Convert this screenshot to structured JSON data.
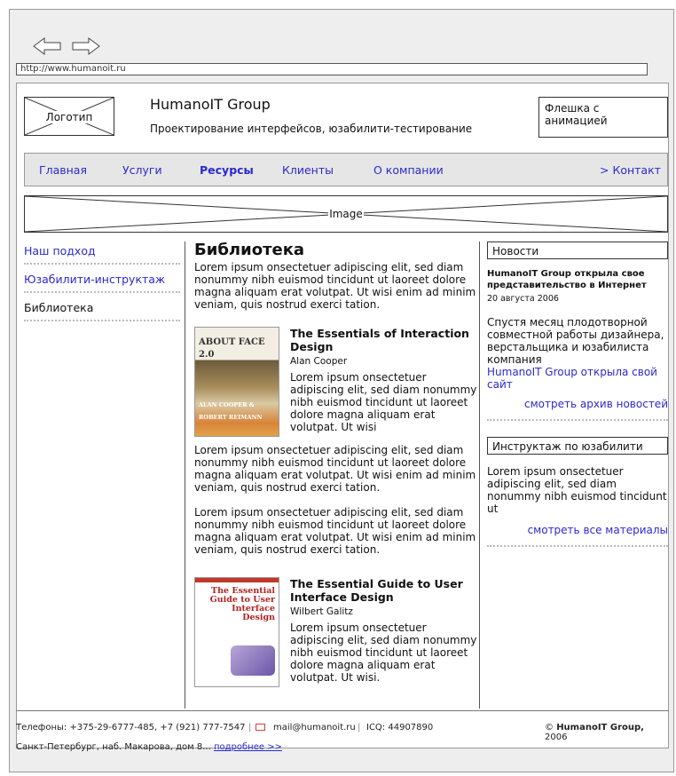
{
  "browser": {
    "url": "http://www.humanoit.ru"
  },
  "header": {
    "logo_label": "Логотип",
    "brand": "HumanoIT Group",
    "tagline": "Проектирование интерфейсов, юзабилити-тестирование",
    "flash_label": "Флешка с анимацией"
  },
  "nav": {
    "items": [
      "Главная",
      "Услуги",
      "Ресурсы",
      "Клиенты",
      "О компании"
    ],
    "contact": "> Контакт"
  },
  "banner": {
    "label": "Image"
  },
  "sidebar": {
    "items": [
      "Наш подход",
      "Юзабилити-инструктаж",
      "Библиотека"
    ]
  },
  "main": {
    "title": "Библиотека",
    "intro": "Lorem ipsum onsectetuer adipiscing elit, sed diam nonummy nibh euismod tincidunt ut laoreet dolore magna aliquam erat volutpat. Ut wisi enim ad minim veniam, quis nostrud exerci tation.",
    "book1": {
      "title": "The Essentials of Interaction Design",
      "author": "Alan Cooper",
      "text": "Lorem ipsum onsectetuer adipiscing elit, sed diam nonummy nibh euismod tincidunt ut laoreet dolore magna aliquam erat volutpat. Ut wisi",
      "cover_title": "ABOUT FACE 2.0",
      "cover_authors": "ALAN COOPER & ROBERT REIMANN"
    },
    "para1": "Lorem ipsum onsectetuer adipiscing elit, sed diam nonummy nibh euismod tincidunt ut laoreet dolore magna aliquam erat volutpat. Ut wisi enim ad minim veniam, quis nostrud exerci tation.",
    "para2": "Lorem ipsum onsectetuer adipiscing elit, sed diam nonummy nibh euismod tincidunt ut laoreet dolore magna aliquam erat volutpat. Ut wisi enim ad minim veniam, quis nostrud exerci tation.",
    "book2": {
      "title": "The Essential Guide to User Interface Design",
      "author": "Wilbert Galitz",
      "text": "Lorem ipsum onsectetuer adipiscing elit, sed diam nonummy nibh euismod tincidunt ut laoreet dolore magna aliquam erat volutpat. Ut wisi.",
      "cover_title": "The Essential Guide to User Interface Design"
    }
  },
  "right": {
    "news_heading": "Новости",
    "news_title": "HumanoIT Group открыла свое представительство в Интернет",
    "news_date": "20 августа 2006",
    "news_text": "Спустя месяц плодотворной совместной работы дизайнера, верстальщика и юзабилиста компания",
    "news_link": "HumanoIT Group открыла свой сайт",
    "news_archive": "смотреть архив новостей",
    "guide_heading": "Инструктаж по юзабилити",
    "guide_text": "Lorem ipsum onsectetuer adipiscing elit, sed diam nonummy nibh euismod tincidunt ut",
    "guide_link": "смотреть все материалы"
  },
  "footer": {
    "phones": "Телефоны: +375-29-6777-485, +7 (921) 777-7547",
    "email": "mail@humanoit.ru",
    "icq": "ICQ: 44907890",
    "copyright_brand": "HumanoIT Group,",
    "copyright_year": "2006",
    "address": "Санкт-Петербург, наб. Макарова, дом 8...",
    "more": "подробнее >>"
  },
  "colors": {
    "link": "#2a2ad0",
    "frame": "#eeeeee",
    "nav_bg": "#e6e6e6"
  }
}
